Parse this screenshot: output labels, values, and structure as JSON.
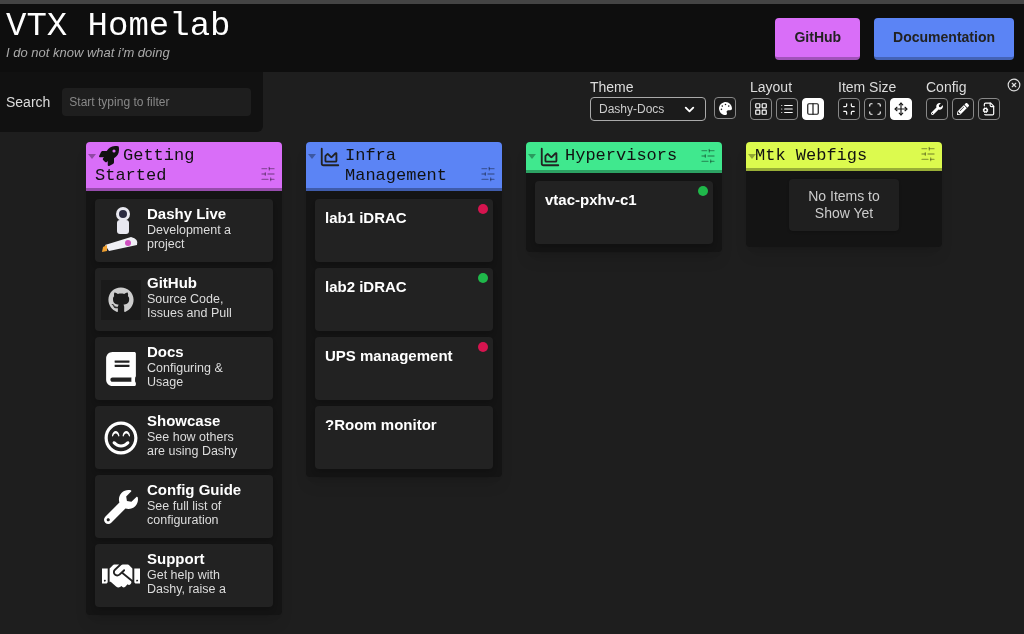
{
  "header": {
    "title": "VTX Homelab",
    "subtitle": "I do not know what i'm doing",
    "links": [
      {
        "label": "GitHub",
        "color": "#d96ef8"
      },
      {
        "label": "Documentation",
        "color": "#5b84f5"
      }
    ]
  },
  "search": {
    "label": "Search",
    "placeholder": "Start typing to filter"
  },
  "settings": {
    "theme": {
      "label": "Theme",
      "value": "Dashy-Docs"
    },
    "layout": {
      "label": "Layout",
      "options": [
        {
          "selected": false
        },
        {
          "selected": false
        },
        {
          "selected": true
        }
      ]
    },
    "item_size": {
      "label": "Item Size",
      "options": [
        {
          "selected": false
        },
        {
          "selected": false
        },
        {
          "selected": true
        }
      ]
    },
    "config": {
      "label": "Config"
    }
  },
  "sections": [
    {
      "title": "Getting Started",
      "color": "#d96ef8",
      "items": [
        {
          "title": "Dashy Live",
          "description": "Development a project"
        },
        {
          "title": "GitHub",
          "description": "Source Code, Issues and Pull"
        },
        {
          "title": "Docs",
          "description": "Configuring & Usage"
        },
        {
          "title": "Showcase",
          "description": "See how others are using Dashy"
        },
        {
          "title": "Config Guide",
          "description": "See full list of configuration"
        },
        {
          "title": "Support",
          "description": "Get help with Dashy, raise a"
        }
      ]
    },
    {
      "title": "Infra Management",
      "color": "#5b84f5",
      "items": [
        {
          "title": "lab1 iDRAC",
          "color": "#d6144f"
        },
        {
          "title": "lab2 iDRAC",
          "color": "#1fb84a"
        },
        {
          "title": "UPS management",
          "color": "#d6144f"
        },
        {
          "title": "?Room monitor"
        }
      ]
    },
    {
      "title": "Hypervisors",
      "color": "#40e88e",
      "items": [
        {
          "title": "vtac-pxhv-c1",
          "color": "#1fb84a"
        }
      ]
    },
    {
      "title": "Mtk Webfigs",
      "color": "#dcfa4e",
      "empty_text": "No Items to Show Yet"
    }
  ]
}
